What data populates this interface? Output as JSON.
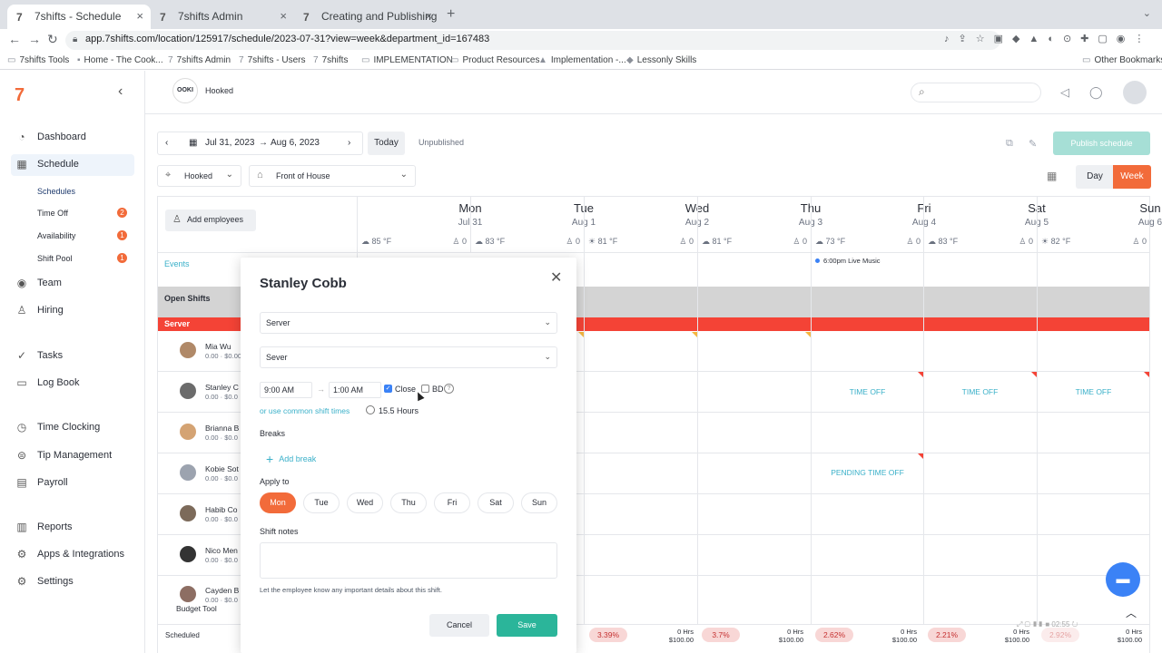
{
  "browser": {
    "tabs": [
      {
        "title": "7shifts - Schedule",
        "favicon": "7"
      },
      {
        "title": "7shifts Admin",
        "favicon": "7"
      },
      {
        "title": "Creating and Publishing a Sche",
        "favicon": "7"
      }
    ],
    "url": "app.7shifts.com/location/125917/schedule/2023-07-31?view=week&department_id=167483",
    "bookmarks": [
      "7shifts Tools",
      "Home - The Cook...",
      "7shifts Admin",
      "7shifts - Users",
      "7shifts",
      "IMPLEMENTATION",
      "Product Resources",
      "Implementation -...",
      "Lessonly Skills",
      "Other Bookmarks"
    ]
  },
  "sidebar": {
    "logo": "7",
    "items": [
      {
        "label": "Dashboard",
        "icon": "dashboard-icon",
        "glyph": "◔"
      },
      {
        "label": "Schedule",
        "icon": "calendar-icon",
        "glyph": "▦"
      },
      {
        "label": "Team",
        "icon": "team-icon",
        "glyph": "◉"
      },
      {
        "label": "Hiring",
        "icon": "person-icon",
        "glyph": "♙"
      },
      {
        "label": "Tasks",
        "icon": "check-icon",
        "glyph": "✓"
      },
      {
        "label": "Log Book",
        "icon": "book-icon",
        "glyph": "▭"
      },
      {
        "label": "Time Clocking",
        "icon": "clock-icon",
        "glyph": "◷"
      },
      {
        "label": "Tip Management",
        "icon": "tip-icon",
        "glyph": "⊜"
      },
      {
        "label": "Payroll",
        "icon": "payroll-icon",
        "glyph": "▤"
      },
      {
        "label": "Reports",
        "icon": "reports-icon",
        "glyph": "▥"
      },
      {
        "label": "Apps & Integrations",
        "icon": "apps-icon",
        "glyph": "⚙"
      },
      {
        "label": "Settings",
        "icon": "gear-icon",
        "glyph": "⚙"
      }
    ],
    "subitems": [
      {
        "label": "Schedules",
        "badge": ""
      },
      {
        "label": "Time Off",
        "badge": "2"
      },
      {
        "label": "Availability",
        "badge": "1"
      },
      {
        "label": "Shift Pool",
        "badge": "1"
      }
    ]
  },
  "header": {
    "brand_logo": "OOKI",
    "location": "Hooked"
  },
  "toolbar": {
    "start_date": "Jul 31, 2023",
    "end_date": "Aug 6, 2023",
    "today": "Today",
    "status": "Unpublished",
    "publish": "Publish schedule",
    "location_filter": "Hooked",
    "department_filter": "Front of House",
    "day": "Day",
    "week": "Week"
  },
  "schedule": {
    "add_employees": "Add employees",
    "days": [
      {
        "name": "Mon",
        "date": "Jul 31",
        "weather": "85 °F",
        "wx_icon": "☁",
        "count": "0"
      },
      {
        "name": "Tue",
        "date": "Aug 1",
        "weather": "83 °F",
        "wx_icon": "☁",
        "count": "0"
      },
      {
        "name": "Wed",
        "date": "Aug 2",
        "weather": "81 °F",
        "wx_icon": "☀",
        "count": "0"
      },
      {
        "name": "Thu",
        "date": "Aug 3",
        "weather": "81 °F",
        "wx_icon": "☁",
        "count": "0"
      },
      {
        "name": "Fri",
        "date": "Aug 4",
        "weather": "73 °F",
        "wx_icon": "☁",
        "count": "0"
      },
      {
        "name": "Sat",
        "date": "Aug 5",
        "weather": "83 °F",
        "wx_icon": "☁",
        "count": "0"
      },
      {
        "name": "Sun",
        "date": "Aug 6",
        "weather": "82 °F",
        "wx_icon": "☀",
        "count": "0"
      }
    ],
    "events_label": "Events",
    "event": "6:00pm Live Music",
    "open_shifts": "Open Shifts",
    "role": "Server",
    "employees": [
      {
        "name": "Mia Wu",
        "hours": "0.00 · $0.00"
      },
      {
        "name": "Stanley C",
        "hours": "0.00 · $0.0"
      },
      {
        "name": "Brianna B",
        "hours": "0.00 · $0.0"
      },
      {
        "name": "Kobie Sot",
        "hours": "0.00 · $0.0"
      },
      {
        "name": "Habib Co",
        "hours": "0.00 · $0.0"
      },
      {
        "name": "Nico Men",
        "hours": "0.00 · $0.0"
      },
      {
        "name": "Cayden B",
        "hours": "0.00 · $0.0"
      }
    ],
    "time_off": "TIME OFF",
    "pending_time_off": "PENDING TIME OFF",
    "budget_tool": "Budget Tool",
    "scheduled": "Scheduled",
    "footer": [
      {
        "pct": "3.39%",
        "hrs": "0 Hrs",
        "amt": "$100.00"
      },
      {
        "pct": "3.7%",
        "hrs": "0 Hrs",
        "amt": "$100.00"
      },
      {
        "pct": "2.62%",
        "hrs": "0 Hrs",
        "amt": "$100.00"
      },
      {
        "pct": "2.21%",
        "hrs": "0 Hrs",
        "amt": "$100.00"
      },
      {
        "pct": "2.92%",
        "hrs": "0 Hrs",
        "amt": "$100.00"
      }
    ]
  },
  "modal": {
    "title": "Stanley Cobb",
    "role": "Server",
    "station": "Sever",
    "start": "9:00 AM",
    "end": "1:00 AM",
    "close_label": "Close",
    "close_checked": true,
    "bd_label": "BD",
    "common_link": "or use common shift times",
    "duration": "15.5 Hours",
    "breaks_label": "Breaks",
    "add_break": "Add break",
    "apply_to": "Apply to",
    "days": [
      "Mon",
      "Tue",
      "Wed",
      "Thu",
      "Fri",
      "Sat",
      "Sun"
    ],
    "active_day": "Mon",
    "notes_label": "Shift notes",
    "notes_help": "Let the employee know any important details about this shift.",
    "cancel": "Cancel",
    "save": "Save"
  },
  "player": {
    "time": "02:55"
  },
  "colors": {
    "accent": "#f26b3a",
    "server": "#f44336",
    "teal": "#2bb59a",
    "link": "#3ab0c9"
  }
}
